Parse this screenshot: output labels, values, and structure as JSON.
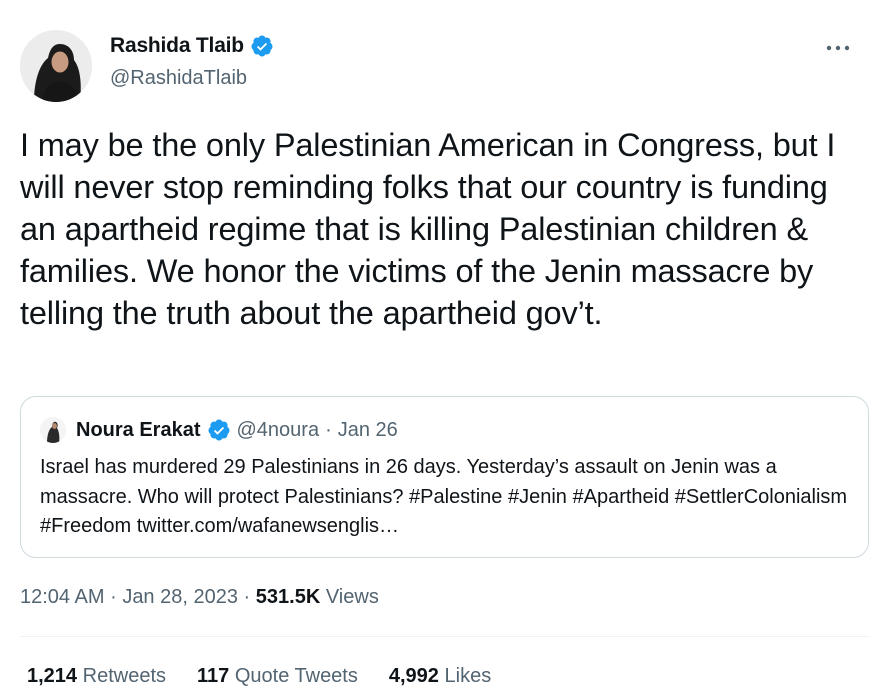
{
  "author": {
    "name": "Rashida Tlaib",
    "handle": "@RashidaTlaib",
    "verified": true
  },
  "tweet": {
    "text": "I may be the only Palestinian American in Congress, but I will never stop reminding folks that our country is funding an apartheid regime that is killing Palestinian children & families. We honor the victims of the Jenin massacre by telling the truth about the apartheid gov’t."
  },
  "quote": {
    "name": "Noura Erakat",
    "handle": "@4noura",
    "separator": "·",
    "date": "Jan 26",
    "text": "Israel has murdered 29 Palestinians in 26 days. Yesterday’s assault on Jenin was a massacre. Who will protect Palestinians? #Palestine #Jenin #Apartheid #SettlerColonialism #Freedom twitter.com/wafanewsenglis…"
  },
  "meta": {
    "time": "12:04 AM",
    "dot1": "·",
    "date": "Jan 28, 2023",
    "dot2": "·",
    "views_count": "531.5K",
    "views_label": "Views"
  },
  "stats": {
    "retweets": {
      "count": "1,214",
      "label": "Retweets"
    },
    "quotes": {
      "count": "117",
      "label": "Quote Tweets"
    },
    "likes": {
      "count": "4,992",
      "label": "Likes"
    }
  },
  "colors": {
    "verified_blue": "#1d9bf0",
    "secondary_text": "#536471",
    "primary_text": "#0f1419",
    "border": "#cfd9de"
  },
  "icons": {
    "verified": "verified-badge-icon",
    "more": "more-options-icon"
  }
}
